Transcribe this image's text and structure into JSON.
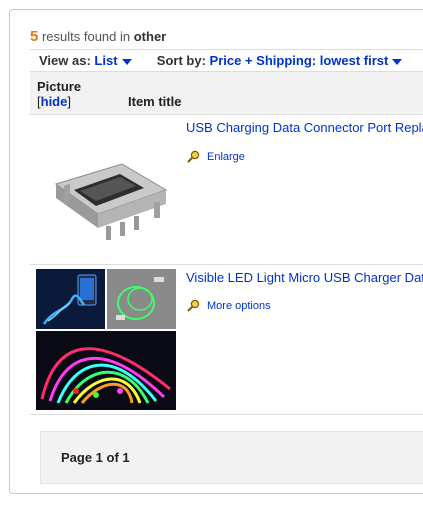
{
  "summary": {
    "count": "5",
    "text_mid": " results found in ",
    "category": "other"
  },
  "viewbar": {
    "view_label": "View as:",
    "view_value": "List",
    "sort_label": "Sort by:",
    "sort_value": "Price + Shipping: lowest first"
  },
  "table_header": {
    "picture": "Picture",
    "hide_open": "[",
    "hide_link": "hide",
    "hide_close": "]",
    "item_title": "Item title"
  },
  "items": [
    {
      "title": "USB Charging Data Connector Port Replacement",
      "action": "Enlarge",
      "action_icon": "magnifier-icon"
    },
    {
      "title": "Visible LED Light Micro USB Charger Data Cable",
      "action": "More options",
      "action_icon": "magnifier-icon"
    }
  ],
  "pager": {
    "text": "Page 1 of 1"
  },
  "colors": {
    "count": "#e47911",
    "link": "#0033cc",
    "header_bg": "#f2f2f2"
  }
}
